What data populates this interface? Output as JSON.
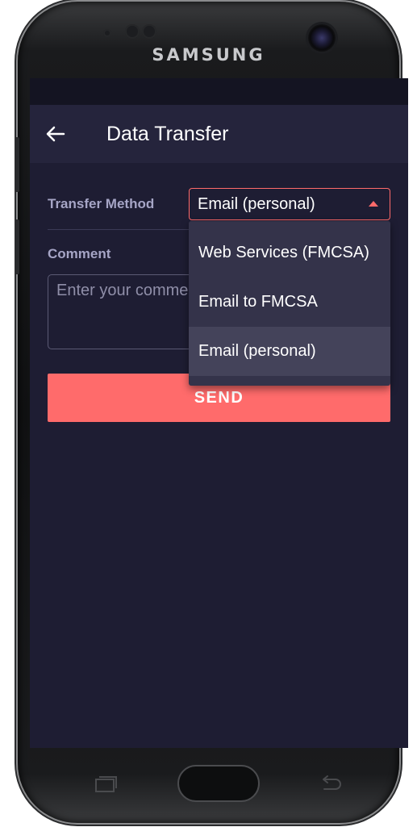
{
  "device": {
    "brand": "SAMSUNG"
  },
  "app_bar": {
    "title": "Data Transfer",
    "back_icon": "arrow-left-icon"
  },
  "form": {
    "transfer_method_label": "Transfer Method",
    "transfer_method_value": "Email (personal)",
    "comment_label": "Comment",
    "comment_placeholder": "Enter your comment",
    "comment_value": "",
    "send_label": "SEND"
  },
  "dropdown": {
    "options": [
      {
        "label": "Web Services (FMCSA)",
        "selected": false
      },
      {
        "label": "Email to FMCSA",
        "selected": false
      },
      {
        "label": "Email (personal)",
        "selected": true
      }
    ]
  },
  "colors": {
    "accent": "#ff6b6b",
    "background": "#1e1d33",
    "app_bar": "#25243c",
    "dropdown_bg": "#34334a",
    "dropdown_selected": "#44435a",
    "label_text": "#a6a5c6"
  }
}
